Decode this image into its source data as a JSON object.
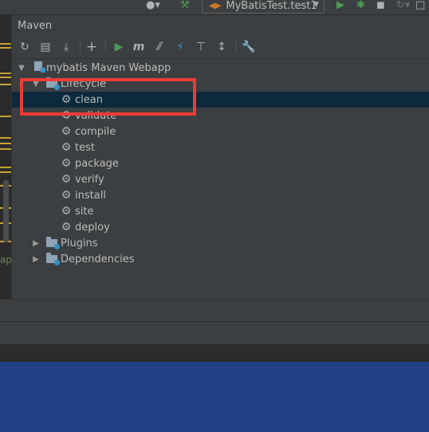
{
  "topbar": {
    "run_config": "MyBatisTest.test1",
    "icons": [
      "user-icon",
      "hammer-icon",
      "run-icon",
      "debug-icon",
      "coverage-icon",
      "profile-icon"
    ]
  },
  "left_strip": {
    "fragment_text": "ap"
  },
  "maven": {
    "panel_title": "Maven",
    "toolbar_icons": [
      "reload-icon",
      "add-maven-project-icon",
      "download-icon",
      "plus-icon",
      "run-icon",
      "execute-goal-icon",
      "toggle-offline-icon",
      "skip-tests-icon",
      "show-dependencies-icon",
      "collapse-all-icon",
      "settings-wrench-icon"
    ],
    "tree": {
      "project": "mybatis Maven Webapp",
      "lifecycle_label": "Lifecycle",
      "goals": [
        "clean",
        "validate",
        "compile",
        "test",
        "package",
        "verify",
        "install",
        "site",
        "deploy"
      ],
      "plugins_label": "Plugins",
      "dependencies_label": "Dependencies",
      "selected_goal": "clean"
    }
  },
  "colors": {
    "ide_background": "#3c3f41",
    "selection": "#0d293e",
    "annotation_red": "#ee3b36",
    "desktop_blue": "#234189",
    "run_green": "#499c54"
  }
}
